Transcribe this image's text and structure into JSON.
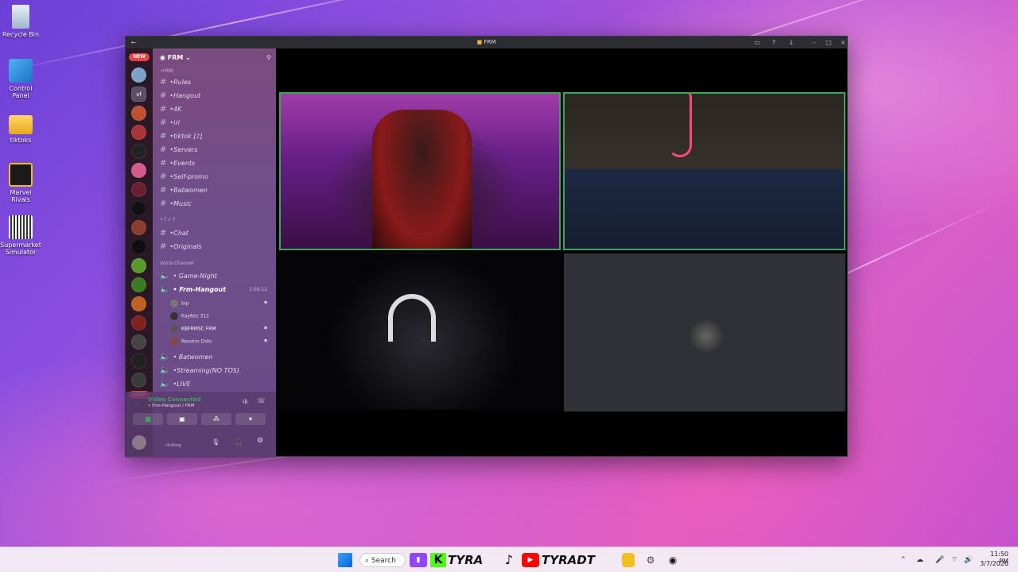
{
  "desktop": {
    "icons": [
      {
        "label": "Recycle Bin",
        "icon": "recycle-bin-icon"
      },
      {
        "label": "Control Panel",
        "icon": "control-panel-icon"
      },
      {
        "label": "tiktoks",
        "icon": "folder-icon"
      },
      {
        "label": "Marvel Rivals",
        "icon": "marvel-rivals-icon"
      },
      {
        "label": "Supermarket Simulator",
        "icon": "supermarket-simulator-icon"
      }
    ]
  },
  "window": {
    "title": "FRM",
    "server_name": "FRM",
    "category_frm": "•FRM",
    "new_badge": "NEW",
    "vf_label": "vf",
    "text_channels": [
      "•Rules",
      "•Hangout",
      "•4K",
      "•irl",
      "•tiktok [♪]",
      "•Servers",
      "•Events",
      "•Self-promo",
      "•Batwomen",
      "•Music"
    ],
    "category_2": "• [ ✓ ]",
    "text_channels_2": [
      "•Chat",
      "•Originals"
    ],
    "voice_category": "Voice Channel",
    "voice_channels": [
      "• Game-Night",
      "• Frm-Hangout",
      "• Batwomen",
      "•Streaming(NO TOS)",
      "•LIVE"
    ],
    "active_timer": "1:09:12",
    "voice_users": [
      {
        "name": "bip",
        "tag": ""
      },
      {
        "name": "Kay8ez",
        "tag": "312"
      },
      {
        "name": "KBFRMSC",
        "tag": "FRM"
      },
      {
        "name": "Rexstro",
        "tag": "Dolo"
      }
    ],
    "panel": {
      "status": "Video Connected",
      "channel": "• Frm-Hangout / FRM",
      "user_status": "chilling"
    }
  },
  "taskbar": {
    "search_label": "Search",
    "brand_text_1": "TYRA",
    "brand_text_2": "TYRADT",
    "time": "11:50 PM",
    "date": "3/7/2026"
  },
  "colors": {
    "speaking_border": "#3ba55d",
    "discord_panel": "#7b4b7f",
    "accent": "#5865f2"
  }
}
